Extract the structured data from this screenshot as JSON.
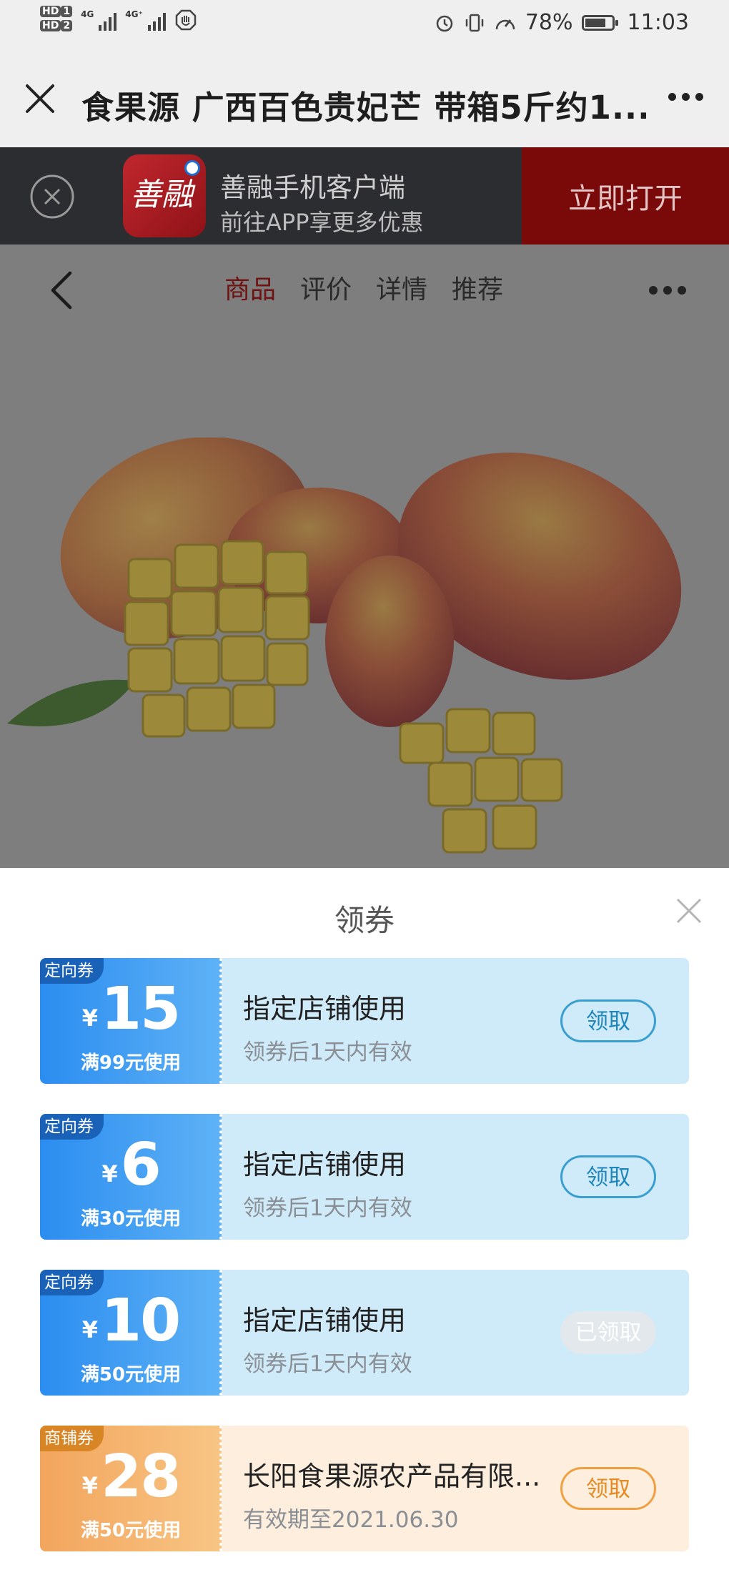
{
  "status_bar": {
    "hd1": "HD",
    "hd1_sub": "1",
    "hd2": "HD",
    "hd2_sub": "2",
    "net1": "4G",
    "net2": "4G⁺",
    "battery_pct_text": "78%",
    "battery_level": 0.78,
    "time": "11:03"
  },
  "title_bar": {
    "title": "食果源 广西百色贵妃芒 带箱5斤约1..."
  },
  "promo": {
    "app_name": "善融手机客户端",
    "subtitle": "前往APP享更多优惠",
    "open_label": "立即打开",
    "logo_text": "善融"
  },
  "product_nav": {
    "tabs": [
      {
        "label": "商品",
        "active": true
      },
      {
        "label": "评价",
        "active": false
      },
      {
        "label": "详情",
        "active": false
      },
      {
        "label": "推荐",
        "active": false
      }
    ]
  },
  "sheet": {
    "title": "领券",
    "coupons": [
      {
        "tag": "定向券",
        "currency": "¥",
        "amount": "15",
        "condition": "满99元使用",
        "title": "指定店铺使用",
        "subtitle": "领券后1天内有效",
        "button": "领取",
        "claimed": false,
        "theme": "blue"
      },
      {
        "tag": "定向券",
        "currency": "¥",
        "amount": "6",
        "condition": "满30元使用",
        "title": "指定店铺使用",
        "subtitle": "领券后1天内有效",
        "button": "领取",
        "claimed": false,
        "theme": "blue"
      },
      {
        "tag": "定向券",
        "currency": "¥",
        "amount": "10",
        "condition": "满50元使用",
        "title": "指定店铺使用",
        "subtitle": "领券后1天内有效",
        "button": "已领取",
        "claimed": true,
        "theme": "blue"
      },
      {
        "tag": "商铺券",
        "currency": "¥",
        "amount": "28",
        "condition": "满50元使用",
        "title": "长阳食果源农产品有限...",
        "subtitle": "有效期至2021.06.30",
        "button": "领取",
        "claimed": false,
        "theme": "orange"
      }
    ]
  },
  "colors": {
    "active_tab": "#6e1212",
    "open_button_bg": "#7a0a0a",
    "coupon_blue": "#2b8df0",
    "coupon_orange": "#f2a55d"
  }
}
